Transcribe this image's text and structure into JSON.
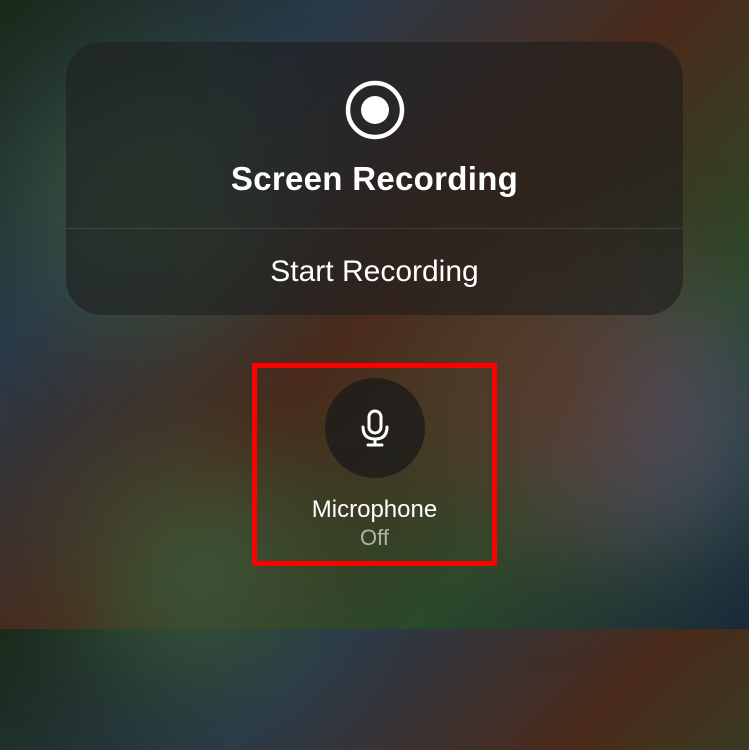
{
  "panel": {
    "title": "Screen Recording",
    "action_label": "Start Recording"
  },
  "microphone": {
    "label": "Microphone",
    "status": "Off"
  },
  "icons": {
    "record": "record-icon",
    "microphone": "microphone-icon"
  }
}
